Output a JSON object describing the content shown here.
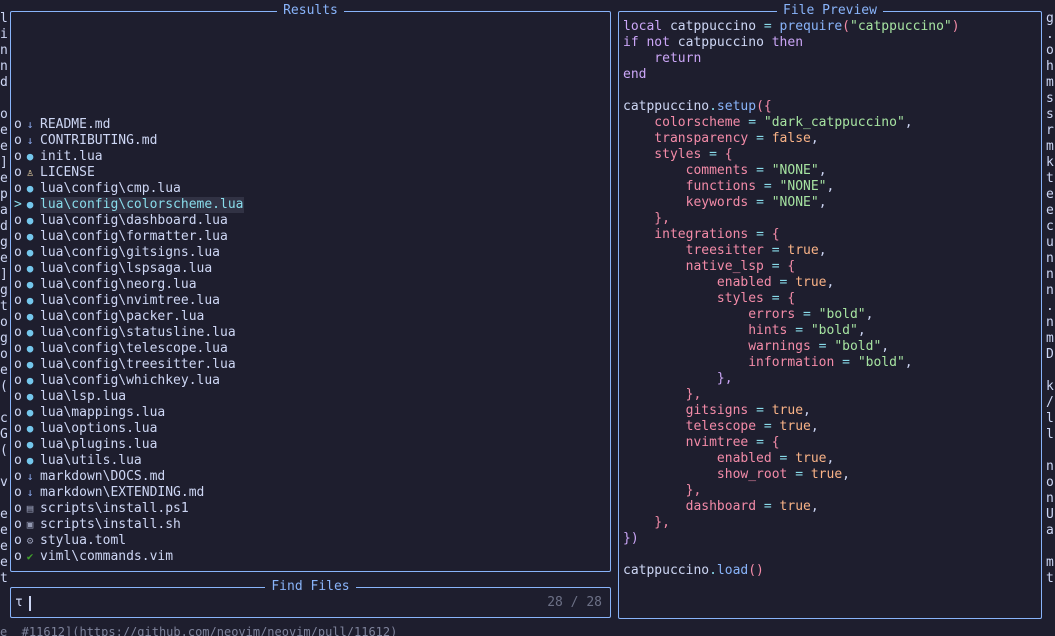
{
  "left_edge_chars": [
    "l",
    "i",
    "n",
    "n",
    "d",
    "",
    "o",
    "e",
    "e",
    "]",
    "e",
    "p",
    "a",
    "d",
    "g",
    "e",
    "]",
    "g",
    "t",
    "o",
    "g",
    "o",
    "e",
    "(",
    "",
    "c",
    "G",
    "(",
    "",
    "v",
    "",
    "e",
    "e",
    "e",
    "e",
    "t"
  ],
  "right_edge_chars": [
    "g",
    ".",
    "o",
    "h",
    "m",
    "s",
    "s",
    "r",
    "m",
    "k",
    "t",
    "e",
    "e",
    "c",
    "u",
    "n",
    "n",
    "n",
    ".",
    "n",
    "m",
    "D",
    "",
    "k",
    "/",
    "l",
    "l",
    "",
    "n",
    "o",
    "n",
    "U",
    "a",
    "",
    "m",
    "t"
  ],
  "bottom_text": "e  #11612](https://github.com/neovim/neovim/pull/11612)",
  "results": {
    "title": "Results",
    "rows": [
      {
        "marker": "o",
        "icon": "↓",
        "icon_name": "markdown-icon",
        "color": "#8caaee",
        "name": "README.md"
      },
      {
        "marker": "o",
        "icon": "↓",
        "icon_name": "markdown-icon",
        "color": "#8caaee",
        "name": "CONTRIBUTING.md"
      },
      {
        "marker": "o",
        "icon": "●",
        "icon_name": "lua-icon",
        "color": "#74c7ec",
        "name": "init.lua"
      },
      {
        "marker": "o",
        "icon": "♙",
        "icon_name": "license-icon",
        "color": "#f9e2af",
        "name": "LICENSE"
      },
      {
        "marker": "o",
        "icon": "●",
        "icon_name": "lua-icon",
        "color": "#74c7ec",
        "name": "lua\\config\\cmp.lua"
      },
      {
        "marker": ">",
        "icon": "●",
        "icon_name": "lua-icon",
        "color": "#74c7ec",
        "name": "lua\\config\\colorscheme.lua",
        "selected": true
      },
      {
        "marker": "o",
        "icon": "●",
        "icon_name": "lua-icon",
        "color": "#74c7ec",
        "name": "lua\\config\\dashboard.lua"
      },
      {
        "marker": "o",
        "icon": "●",
        "icon_name": "lua-icon",
        "color": "#74c7ec",
        "name": "lua\\config\\formatter.lua"
      },
      {
        "marker": "o",
        "icon": "●",
        "icon_name": "lua-icon",
        "color": "#74c7ec",
        "name": "lua\\config\\gitsigns.lua"
      },
      {
        "marker": "o",
        "icon": "●",
        "icon_name": "lua-icon",
        "color": "#74c7ec",
        "name": "lua\\config\\lspsaga.lua"
      },
      {
        "marker": "o",
        "icon": "●",
        "icon_name": "lua-icon",
        "color": "#74c7ec",
        "name": "lua\\config\\neorg.lua"
      },
      {
        "marker": "o",
        "icon": "●",
        "icon_name": "lua-icon",
        "color": "#74c7ec",
        "name": "lua\\config\\nvimtree.lua"
      },
      {
        "marker": "o",
        "icon": "●",
        "icon_name": "lua-icon",
        "color": "#74c7ec",
        "name": "lua\\config\\packer.lua"
      },
      {
        "marker": "o",
        "icon": "●",
        "icon_name": "lua-icon",
        "color": "#74c7ec",
        "name": "lua\\config\\statusline.lua"
      },
      {
        "marker": "o",
        "icon": "●",
        "icon_name": "lua-icon",
        "color": "#74c7ec",
        "name": "lua\\config\\telescope.lua"
      },
      {
        "marker": "o",
        "icon": "●",
        "icon_name": "lua-icon",
        "color": "#74c7ec",
        "name": "lua\\config\\treesitter.lua"
      },
      {
        "marker": "o",
        "icon": "●",
        "icon_name": "lua-icon",
        "color": "#74c7ec",
        "name": "lua\\config\\whichkey.lua"
      },
      {
        "marker": "o",
        "icon": "●",
        "icon_name": "lua-icon",
        "color": "#74c7ec",
        "name": "lua\\lsp.lua"
      },
      {
        "marker": "o",
        "icon": "●",
        "icon_name": "lua-icon",
        "color": "#74c7ec",
        "name": "lua\\mappings.lua"
      },
      {
        "marker": "o",
        "icon": "●",
        "icon_name": "lua-icon",
        "color": "#74c7ec",
        "name": "lua\\options.lua"
      },
      {
        "marker": "o",
        "icon": "●",
        "icon_name": "lua-icon",
        "color": "#74c7ec",
        "name": "lua\\plugins.lua"
      },
      {
        "marker": "o",
        "icon": "●",
        "icon_name": "lua-icon",
        "color": "#74c7ec",
        "name": "lua\\utils.lua"
      },
      {
        "marker": "o",
        "icon": "↓",
        "icon_name": "markdown-icon",
        "color": "#8caaee",
        "name": "markdown\\DOCS.md"
      },
      {
        "marker": "o",
        "icon": "↓",
        "icon_name": "markdown-icon",
        "color": "#8caaee",
        "name": "markdown\\EXTENDING.md"
      },
      {
        "marker": "o",
        "icon": "▤",
        "icon_name": "powershell-icon",
        "color": "#9399b2",
        "name": "scripts\\install.ps1"
      },
      {
        "marker": "o",
        "icon": "▣",
        "icon_name": "shell-icon",
        "color": "#9399b2",
        "name": "scripts\\install.sh"
      },
      {
        "marker": "o",
        "icon": "⚙",
        "icon_name": "gear-icon",
        "color": "#9399b2",
        "name": "stylua.toml"
      },
      {
        "marker": "o",
        "icon": "✔",
        "icon_name": "vim-icon",
        "color": "#40a02b",
        "name": "viml\\commands.vim"
      }
    ]
  },
  "prompt": {
    "title": "Find Files",
    "prefix": "τ",
    "value": "",
    "counter": "28 / 28"
  },
  "preview": {
    "title": "File Preview",
    "lines": [
      [
        [
          "local ",
          "#cba6f7"
        ],
        [
          "catppuccino ",
          "#cdd6f4"
        ],
        [
          "= ",
          "#89dceb"
        ],
        [
          "prequire",
          "#89b4fa"
        ],
        [
          "(",
          "#f38ba8"
        ],
        [
          "\"catppuccino\"",
          "#a6e3a1"
        ],
        [
          ")",
          "#f38ba8"
        ]
      ],
      [
        [
          "if ",
          "#cba6f7"
        ],
        [
          "not ",
          "#cba6f7"
        ],
        [
          "catppuccino ",
          "#cdd6f4"
        ],
        [
          "then",
          "#cba6f7"
        ]
      ],
      [
        [
          "    return",
          "#cba6f7"
        ]
      ],
      [
        [
          "end",
          "#cba6f7"
        ]
      ],
      [],
      [
        [
          "catppuccino",
          "#cdd6f4"
        ],
        [
          ".",
          "#89dceb"
        ],
        [
          "setup",
          "#89b4fa"
        ],
        [
          "({",
          "#f38ba8"
        ]
      ],
      [
        [
          "    colorscheme ",
          "#f38ba8"
        ],
        [
          "= ",
          "#89dceb"
        ],
        [
          "\"dark_catppuccino\"",
          "#a6e3a1"
        ],
        [
          ",",
          "#cdd6f4"
        ]
      ],
      [
        [
          "    transparency ",
          "#f38ba8"
        ],
        [
          "= ",
          "#89dceb"
        ],
        [
          "false",
          "#fab387"
        ],
        [
          ",",
          "#cdd6f4"
        ]
      ],
      [
        [
          "    styles ",
          "#f38ba8"
        ],
        [
          "= ",
          "#89dceb"
        ],
        [
          "{",
          "#f38ba8"
        ]
      ],
      [
        [
          "        comments ",
          "#f38ba8"
        ],
        [
          "= ",
          "#89dceb"
        ],
        [
          "\"NONE\"",
          "#a6e3a1"
        ],
        [
          ",",
          "#cdd6f4"
        ]
      ],
      [
        [
          "        functions ",
          "#f38ba8"
        ],
        [
          "= ",
          "#89dceb"
        ],
        [
          "\"NONE\"",
          "#a6e3a1"
        ],
        [
          ",",
          "#cdd6f4"
        ]
      ],
      [
        [
          "        keywords ",
          "#f38ba8"
        ],
        [
          "= ",
          "#89dceb"
        ],
        [
          "\"NONE\"",
          "#a6e3a1"
        ],
        [
          ",",
          "#cdd6f4"
        ]
      ],
      [
        [
          "    },",
          "#f38ba8"
        ]
      ],
      [
        [
          "    integrations ",
          "#f38ba8"
        ],
        [
          "= ",
          "#89dceb"
        ],
        [
          "{",
          "#f38ba8"
        ]
      ],
      [
        [
          "        treesitter ",
          "#f38ba8"
        ],
        [
          "= ",
          "#89dceb"
        ],
        [
          "true",
          "#fab387"
        ],
        [
          ",",
          "#cdd6f4"
        ]
      ],
      [
        [
          "        native_lsp ",
          "#f38ba8"
        ],
        [
          "= ",
          "#89dceb"
        ],
        [
          "{",
          "#f38ba8"
        ]
      ],
      [
        [
          "            enabled ",
          "#f38ba8"
        ],
        [
          "= ",
          "#89dceb"
        ],
        [
          "true",
          "#fab387"
        ],
        [
          ",",
          "#cdd6f4"
        ]
      ],
      [
        [
          "            styles ",
          "#f38ba8"
        ],
        [
          "= ",
          "#89dceb"
        ],
        [
          "{",
          "#f38ba8"
        ]
      ],
      [
        [
          "                errors ",
          "#f38ba8"
        ],
        [
          "= ",
          "#89dceb"
        ],
        [
          "\"bold\"",
          "#a6e3a1"
        ],
        [
          ",",
          "#cdd6f4"
        ]
      ],
      [
        [
          "                hints ",
          "#f38ba8"
        ],
        [
          "= ",
          "#89dceb"
        ],
        [
          "\"bold\"",
          "#a6e3a1"
        ],
        [
          ",",
          "#cdd6f4"
        ]
      ],
      [
        [
          "                warnings ",
          "#f38ba8"
        ],
        [
          "= ",
          "#89dceb"
        ],
        [
          "\"bold\"",
          "#a6e3a1"
        ],
        [
          ",",
          "#cdd6f4"
        ]
      ],
      [
        [
          "                information ",
          "#f38ba8"
        ],
        [
          "= ",
          "#89dceb"
        ],
        [
          "\"bold\"",
          "#a6e3a1"
        ],
        [
          ",",
          "#cdd6f4"
        ]
      ],
      [
        [
          "            },",
          "#cba6f7"
        ]
      ],
      [
        [
          "        },",
          "#f38ba8"
        ]
      ],
      [
        [
          "        gitsigns ",
          "#f38ba8"
        ],
        [
          "= ",
          "#89dceb"
        ],
        [
          "true",
          "#fab387"
        ],
        [
          ",",
          "#cdd6f4"
        ]
      ],
      [
        [
          "        telescope ",
          "#f38ba8"
        ],
        [
          "= ",
          "#89dceb"
        ],
        [
          "true",
          "#fab387"
        ],
        [
          ",",
          "#cdd6f4"
        ]
      ],
      [
        [
          "        nvimtree ",
          "#f38ba8"
        ],
        [
          "= ",
          "#89dceb"
        ],
        [
          "{",
          "#f38ba8"
        ]
      ],
      [
        [
          "            enabled ",
          "#f38ba8"
        ],
        [
          "= ",
          "#89dceb"
        ],
        [
          "true",
          "#fab387"
        ],
        [
          ",",
          "#cdd6f4"
        ]
      ],
      [
        [
          "            show_root ",
          "#f38ba8"
        ],
        [
          "= ",
          "#89dceb"
        ],
        [
          "true",
          "#fab387"
        ],
        [
          ",",
          "#cdd6f4"
        ]
      ],
      [
        [
          "        },",
          "#f38ba8"
        ]
      ],
      [
        [
          "        dashboard ",
          "#f38ba8"
        ],
        [
          "= ",
          "#89dceb"
        ],
        [
          "true",
          "#fab387"
        ],
        [
          ",",
          "#cdd6f4"
        ]
      ],
      [
        [
          "    },",
          "#f38ba8"
        ]
      ],
      [
        [
          "})",
          "#cba6f7"
        ]
      ],
      [],
      [
        [
          "catppuccino",
          "#cdd6f4"
        ],
        [
          ".",
          "#89dceb"
        ],
        [
          "load",
          "#89b4fa"
        ],
        [
          "()",
          "#f38ba8"
        ]
      ]
    ]
  }
}
